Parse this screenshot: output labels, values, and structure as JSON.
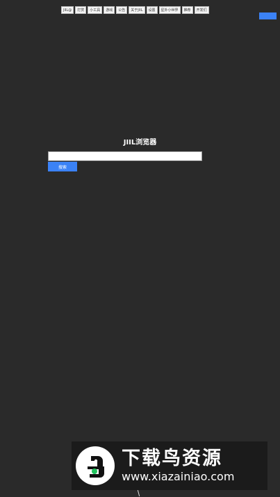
{
  "nav": {
    "items": [
      {
        "label": "JIIL@"
      },
      {
        "label": "打赏"
      },
      {
        "label": "小工具"
      },
      {
        "label": "游戏"
      },
      {
        "label": "公告"
      },
      {
        "label": "关于JIIL"
      },
      {
        "label": "设置"
      },
      {
        "label": "星外小世界"
      },
      {
        "label": "推荐"
      },
      {
        "label": "开发们"
      }
    ]
  },
  "main": {
    "title": "JIIL浏览器",
    "search_value": "",
    "search_button_label": "搜索"
  },
  "colors": {
    "background": "#2a2a2a",
    "accent": "#3b82f6"
  },
  "watermark": {
    "brand_cn": "下载鸟资源",
    "url": "www.xiazainiao.com"
  }
}
